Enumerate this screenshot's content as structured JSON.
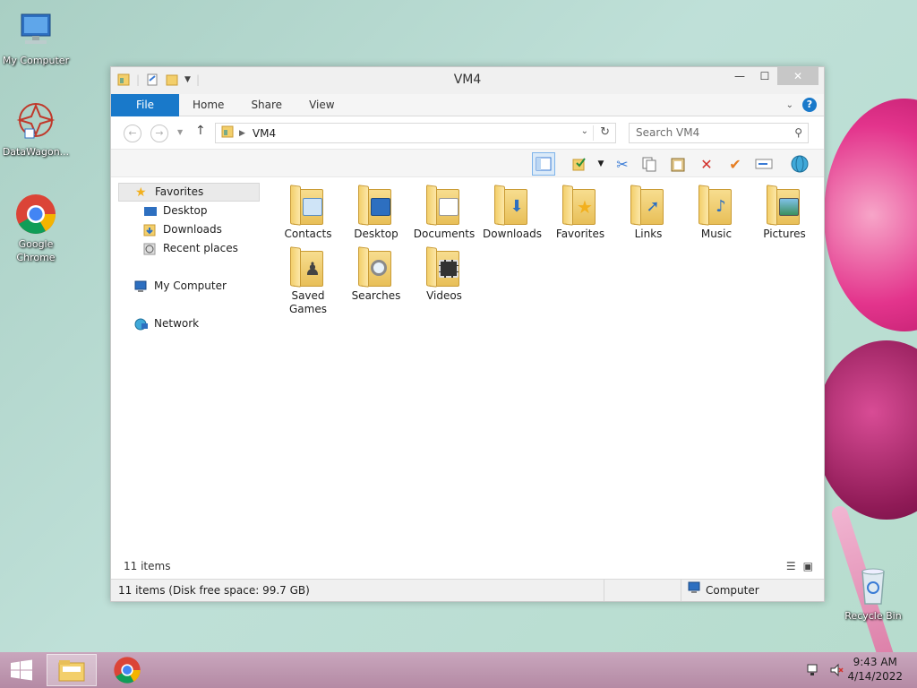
{
  "desktop": {
    "icons": [
      {
        "label": "My Computer"
      },
      {
        "label": "DataWagon..."
      },
      {
        "label": "Google Chrome"
      },
      {
        "label": "Recycle Bin"
      }
    ]
  },
  "window": {
    "title": "VM4",
    "ribbon": {
      "tabs": [
        "File",
        "Home",
        "Share",
        "View"
      ]
    },
    "address": {
      "path": "VM4",
      "search_placeholder": "Search VM4"
    },
    "nav_pane": {
      "favorites": "Favorites",
      "favorites_items": [
        "Desktop",
        "Downloads",
        "Recent places"
      ],
      "computer": "My Computer",
      "network": "Network"
    },
    "files": [
      {
        "label": "Contacts",
        "icon": "contacts-folder-icon"
      },
      {
        "label": "Desktop",
        "icon": "desktop-folder-icon"
      },
      {
        "label": "Documents",
        "icon": "documents-folder-icon"
      },
      {
        "label": "Downloads",
        "icon": "downloads-folder-icon"
      },
      {
        "label": "Favorites",
        "icon": "favorites-folder-icon"
      },
      {
        "label": "Links",
        "icon": "links-folder-icon"
      },
      {
        "label": "Music",
        "icon": "music-folder-icon"
      },
      {
        "label": "Pictures",
        "icon": "pictures-folder-icon"
      },
      {
        "label": "Saved Games",
        "icon": "saved-games-folder-icon"
      },
      {
        "label": "Searches",
        "icon": "searches-folder-icon"
      },
      {
        "label": "Videos",
        "icon": "videos-folder-icon"
      }
    ],
    "item_count": "11 items",
    "status": {
      "left": "11 items (Disk free space: 99.7 GB)",
      "right": "Computer"
    }
  },
  "taskbar": {
    "time": "9:43 AM",
    "date": "4/14/2022"
  }
}
